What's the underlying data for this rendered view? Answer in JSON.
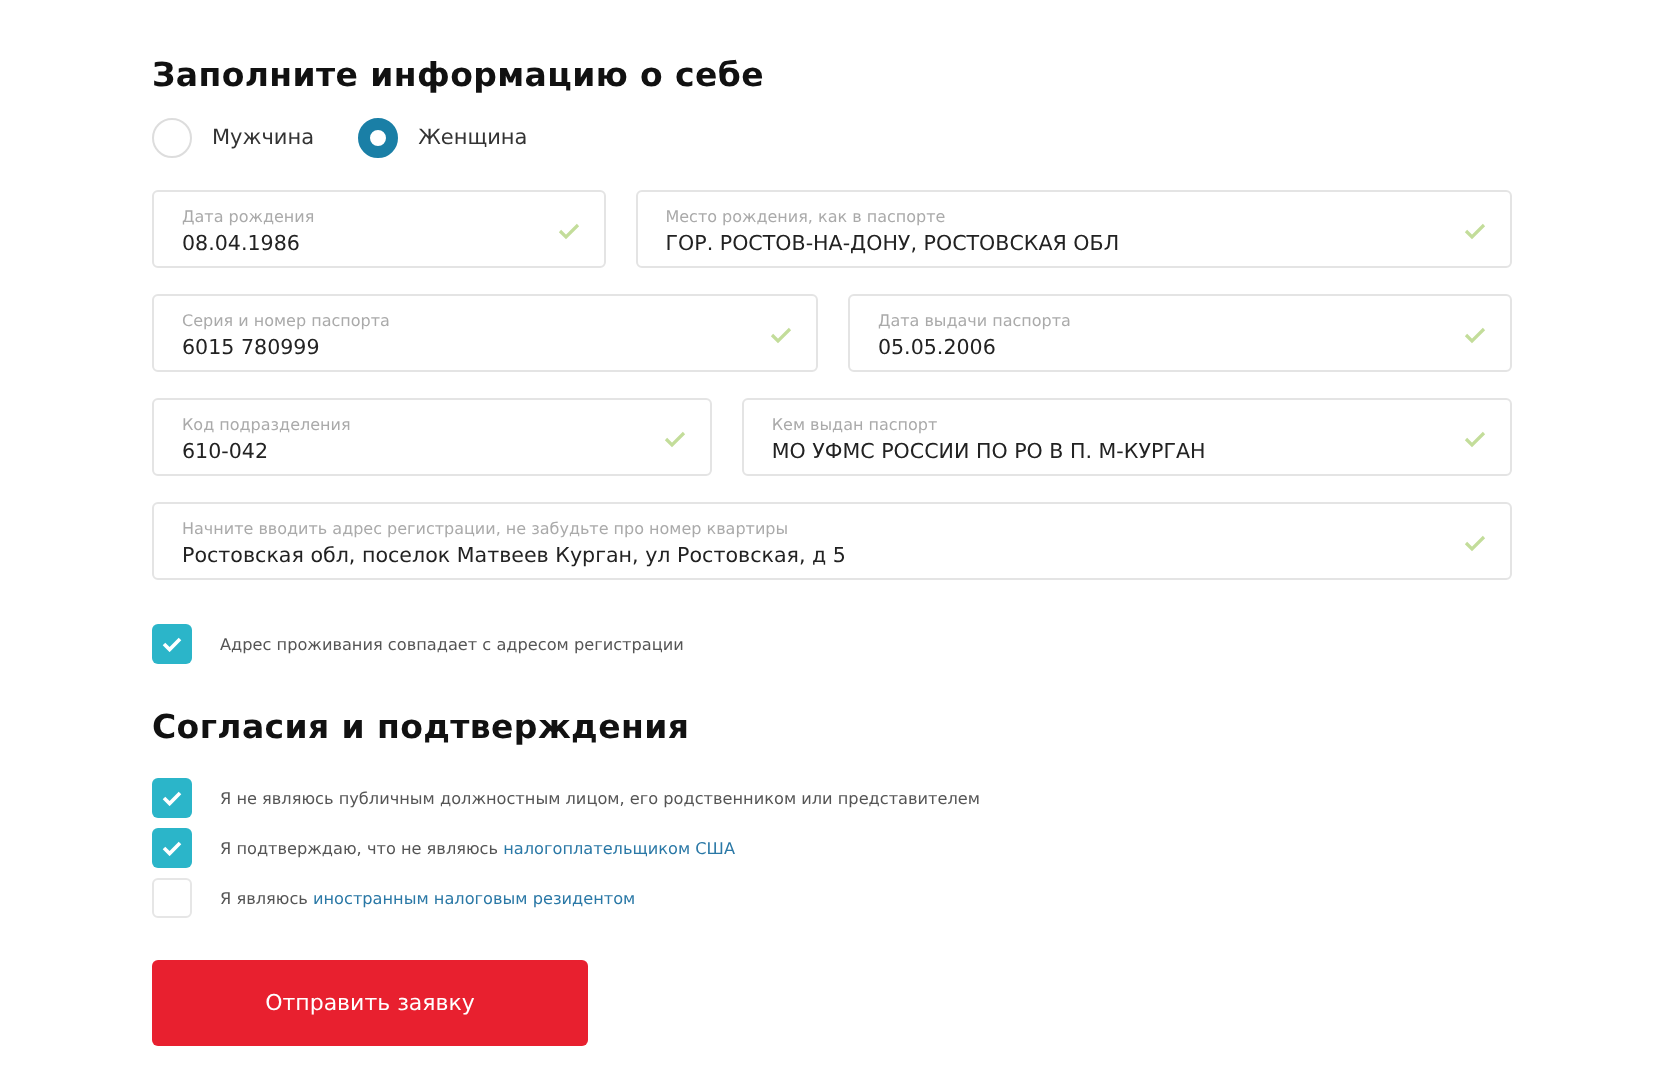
{
  "personal_section": {
    "title": "Заполните информацию о себе",
    "gender": [
      {
        "label": "Мужчина",
        "selected": false
      },
      {
        "label": "Женщина",
        "selected": true
      }
    ],
    "field_rows": [
      [
        {
          "label": "Дата рождения",
          "value": "08.04.1986",
          "valid": true
        },
        {
          "label": "Место рождения, как в паспорте",
          "value": "ГОР. РОСТОВ-НА-ДОНУ, РОСТОВСКАЯ ОБЛ",
          "valid": true
        }
      ],
      [
        {
          "label": "Серия и номер паспорта",
          "value": "6015 780999",
          "valid": true
        },
        {
          "label": "Дата выдачи паспорта",
          "value": "05.05.2006",
          "valid": true
        }
      ],
      [
        {
          "label": "Код подразделения",
          "value": "610-042",
          "valid": true
        },
        {
          "label": "Кем выдан паспорт",
          "value": "МО УФМС РОССИИ ПО РО В П. М-КУРГАН",
          "valid": true
        }
      ],
      [
        {
          "label": "Начните вводить адрес регистрации, не забудьте про номер квартиры",
          "value": "Ростовская обл, поселок Матвеев Курган, ул Ростовская, д 5",
          "valid": true
        }
      ]
    ],
    "same_address": {
      "label": "Адрес проживания совпадает с адресом регистрации",
      "checked": true
    }
  },
  "consents_section": {
    "title": "Согласия и подтверждения",
    "items": [
      {
        "text": "Я не являюсь публичным должностным лицом, его родственником или представителем",
        "checked": true
      },
      {
        "text": "Я подтверждаю, что не являюсь ",
        "link": "налогоплательщиком США",
        "checked": true
      },
      {
        "text": "Я являюсь ",
        "link": "иностранным налоговым резидентом",
        "checked": false
      }
    ]
  },
  "submit_button": "Отправить заявку"
}
